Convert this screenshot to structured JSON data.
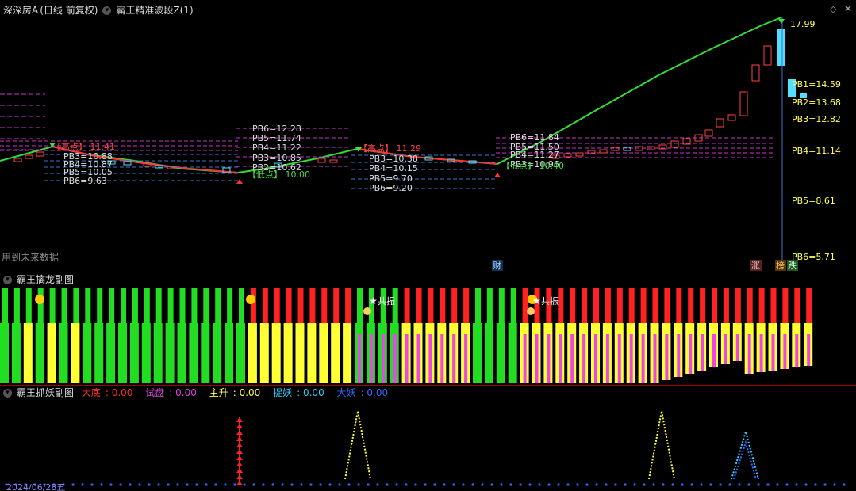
{
  "main_panel": {
    "stock_name": "深深房A",
    "period_label": "(日线 前复权)",
    "indicator_name": "霸王精准波段Z(1)",
    "future_data_note": "用到未来数据",
    "last_price": "17.99",
    "high_marker_text": "【高点】",
    "low_marker_text": "【低点】",
    "cai_label": "财",
    "zhang_label": "涨",
    "bang_label": "榜",
    "die_label": "跌",
    "colors": {
      "wave_line": "#33dd33",
      "down_wave": "#ff3333",
      "pb_upper": "#cc33cc",
      "pb_lower": "#3377cc",
      "label": "#dddddd",
      "yellow_text": "#ffff55"
    }
  },
  "chart_data": [
    {
      "type": "line",
      "title": "霸王精准波段Z(1)",
      "xlabel": "",
      "ylabel": "",
      "ylim": [
        5.0,
        18.5
      ],
      "highs_lows": [
        {
          "label": "高点",
          "value": 11.41
        },
        {
          "label": "低点",
          "value": 10.0
        },
        {
          "label": "高点",
          "value": 11.29
        },
        {
          "label": "低点",
          "value": 10.4
        },
        {
          "label": "last",
          "value": 17.99
        }
      ],
      "pb_groups": [
        {
          "labels": [
            "PB3=10.88",
            "PB4=10.87",
            "PB5=10.05",
            "PB6=9.63"
          ]
        },
        {
          "labels": [
            "PB6=12.28",
            "PB5=11.74",
            "PB4=11.22",
            "PB3=10.85",
            "PB2=10.62"
          ]
        },
        {
          "labels": [
            "PB3=10.38",
            "PB4=10.15",
            "PB5=9.70",
            "PB6=9.20"
          ]
        },
        {
          "labels": [
            "PB6=11.84",
            "PB5=11.50",
            "PB4=11.27",
            "PB3=10.96"
          ]
        },
        {
          "labels": [
            "PB1=14.59",
            "PB2=13.68",
            "PB3=12.82",
            "PB4=11.14",
            "PB5=8.61",
            "PB6=5.71"
          ]
        }
      ]
    },
    {
      "type": "bar",
      "title": "霸王擒龙副图",
      "top_signal_labels": [
        "共振",
        "共振"
      ]
    },
    {
      "type": "line",
      "title": "霸王抓妖副图",
      "legend": [
        {
          "name": "大底",
          "value": "0.00",
          "color": "#ff3333"
        },
        {
          "name": "试盘",
          "value": "0.00",
          "color": "#dd44dd"
        },
        {
          "name": "主升",
          "value": "0.00",
          "color": "#ffff55"
        },
        {
          "name": "捉妖",
          "value": "0.00",
          "color": "#33ccff"
        },
        {
          "name": "大妖",
          "value": "0.00",
          "color": "#3366ff"
        }
      ],
      "date_label": "2024/06/28五"
    }
  ]
}
